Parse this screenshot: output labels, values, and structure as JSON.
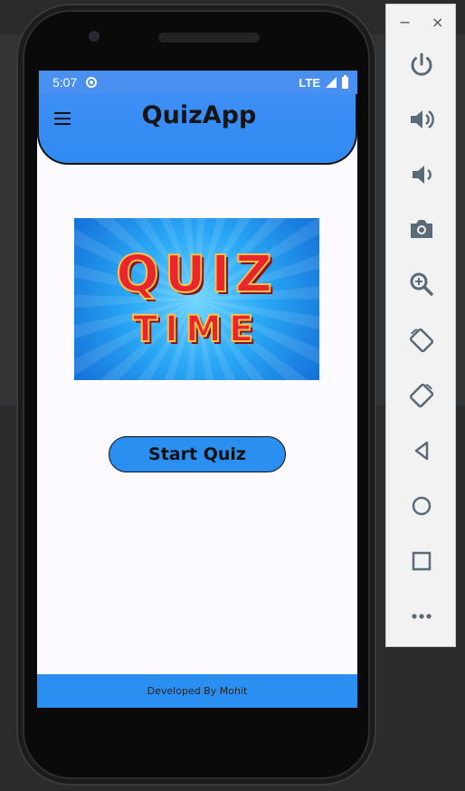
{
  "status_bar": {
    "time": "5:07",
    "network": "LTE"
  },
  "app_bar": {
    "title": "QuizApp"
  },
  "banner": {
    "line1": "QUIZ",
    "line2": "TIME"
  },
  "main": {
    "start_button_label": "Start Quiz"
  },
  "footer": {
    "text": "Developed By Mohit"
  },
  "emulator_toolbar": {
    "minimize_label": "−",
    "close_label": "×",
    "icons": [
      "power-icon",
      "volume-up-icon",
      "volume-down-icon",
      "camera-icon",
      "zoom-icon",
      "rotate-left-icon",
      "rotate-right-icon",
      "back-icon",
      "home-icon",
      "overview-icon",
      "more-icon"
    ]
  },
  "colors": {
    "accent_blue": "#2a8ff0",
    "app_bar_gradient_top": "#4a90f0",
    "banner_text_red": "#e8262b",
    "toolbar_icon_gray": "#5a6a78"
  }
}
